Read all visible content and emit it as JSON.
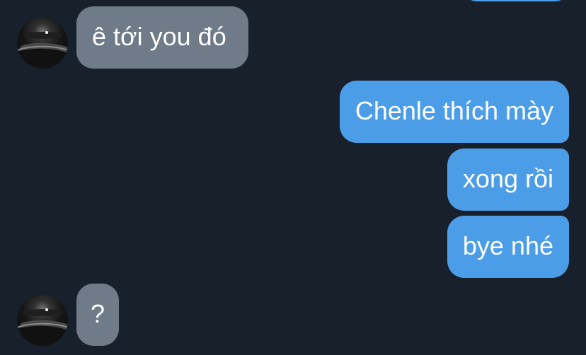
{
  "conversation": {
    "messages": [
      {
        "direction": "incoming",
        "text": "ê tới you đó"
      },
      {
        "direction": "outgoing",
        "text": "Chenle thích mày"
      },
      {
        "direction": "outgoing",
        "text": "xong rồi"
      },
      {
        "direction": "outgoing",
        "text": "bye nhé"
      },
      {
        "direction": "incoming",
        "text": "?"
      }
    ]
  },
  "colors": {
    "background": "#18202b",
    "incoming_bubble": "#6f7b89",
    "outgoing_bubble": "#4b9de8",
    "text": "#ffffff"
  },
  "icons": {
    "avatar": "contact-avatar-icon"
  }
}
